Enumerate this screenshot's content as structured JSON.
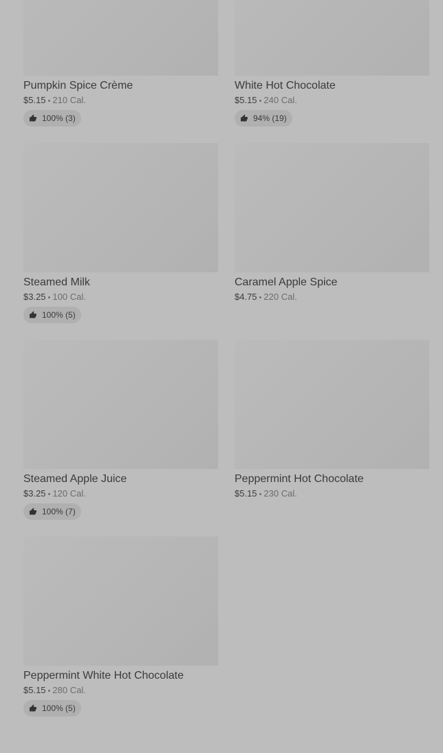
{
  "items": [
    {
      "name": "Pumpkin Spice Crème",
      "price": "$5.15",
      "sep": "•",
      "calories": "210 Cal.",
      "rating": "100% (3)"
    },
    {
      "name": "White Hot Chocolate",
      "price": "$5.15",
      "sep": "•",
      "calories": "240 Cal.",
      "rating": "94% (19)"
    },
    {
      "name": "Steamed Milk",
      "price": "$3.25",
      "sep": "•",
      "calories": "100 Cal.",
      "rating": "100% (5)"
    },
    {
      "name": "Caramel Apple Spice",
      "price": "$4.75",
      "sep": "•",
      "calories": "220 Cal.",
      "rating": ""
    },
    {
      "name": "Steamed Apple Juice",
      "price": "$3.25",
      "sep": "•",
      "calories": "120 Cal.",
      "rating": "100% (7)"
    },
    {
      "name": "Peppermint Hot Chocolate",
      "price": "$5.15",
      "sep": "•",
      "calories": "230 Cal.",
      "rating": ""
    },
    {
      "name": "Peppermint White Hot Chocolate",
      "price": "$5.15",
      "sep": "•",
      "calories": "280 Cal.",
      "rating": "100% (5)"
    }
  ],
  "icons": {
    "rating": "thumbs-up-icon"
  }
}
